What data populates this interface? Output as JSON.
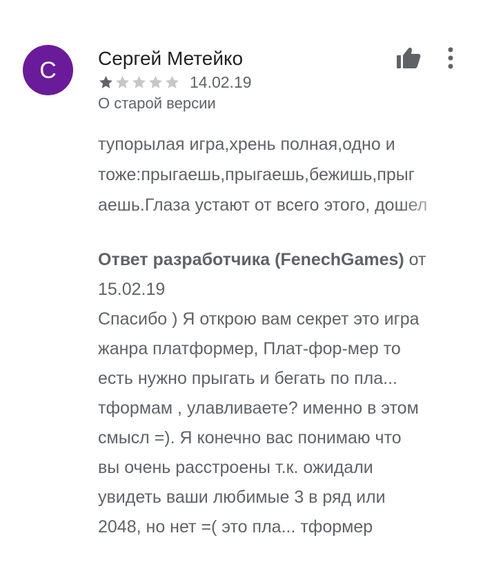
{
  "review": {
    "author_initial": "С",
    "author_name": "Сергей Метейко",
    "rating": 1,
    "max_rating": 5,
    "date": "14.02.19",
    "version_note": "О старой версии",
    "text_lines": [
      "тупорылая игра,хрень полная,одно и",
      "тоже:прыгаешь,прыгаешь,бежишь,прыг",
      "аешь.Глаза устают от всего этого, дошел"
    ]
  },
  "developer_reply": {
    "label": "Ответ разработчика (FenechGames)",
    "from_word": " от",
    "date": "15.02.19",
    "lines": [
      "Спасибо ) Я открою вам секрет это игра",
      "жанра платформер, Плат-фор-мер то",
      "есть нужно прыгать и бегать по пла...",
      "тформам , улавливаете? именно в этом",
      "смысл =). Я конечно вас понимаю что",
      "вы очень расстроены т.к. ожидали",
      "увидеть ваши любимые 3 в ряд или",
      "2048, но нет =( это пла... тформер"
    ]
  },
  "icons": {
    "helpful": "thumbs-up-icon",
    "more": "more-vert-icon",
    "star": "star-icon"
  },
  "colors": {
    "avatar": "#6a1b9a",
    "text_primary": "#202124",
    "text_secondary": "#5f6368",
    "star_filled": "#5f6368",
    "star_empty": "#c7c7c7"
  }
}
